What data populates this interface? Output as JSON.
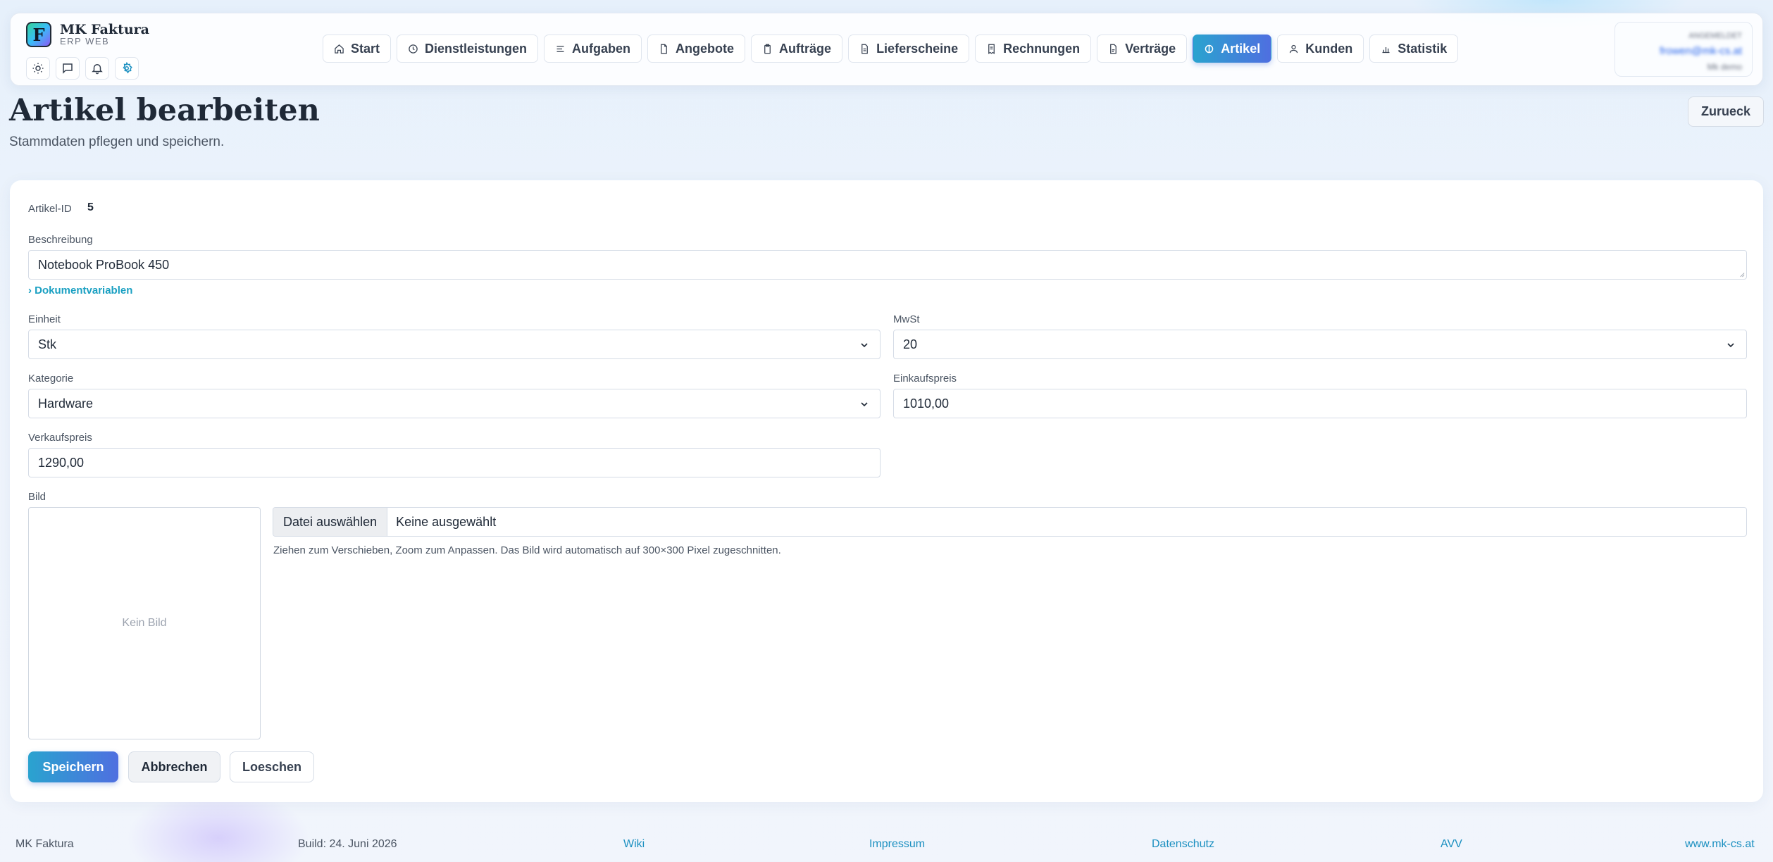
{
  "app": {
    "name": "MK Faktura",
    "subtitle": "ERP WEB",
    "logo_letter": "F"
  },
  "header_icons": [
    "sun-icon",
    "chat-icon",
    "bell-icon",
    "gear-icon"
  ],
  "nav": {
    "items": [
      {
        "label": "Start",
        "icon": "home-icon"
      },
      {
        "label": "Dienstleistungen",
        "icon": "clock-icon"
      },
      {
        "label": "Aufgaben",
        "icon": "list-icon"
      },
      {
        "label": "Angebote",
        "icon": "document-icon"
      },
      {
        "label": "Aufträge",
        "icon": "clipboard-icon"
      },
      {
        "label": "Lieferscheine",
        "icon": "document-icon"
      },
      {
        "label": "Rechnungen",
        "icon": "receipt-icon"
      },
      {
        "label": "Verträge",
        "icon": "document-icon"
      },
      {
        "label": "Artikel",
        "icon": "tag-icon",
        "active": true
      },
      {
        "label": "Kunden",
        "icon": "user-icon"
      },
      {
        "label": "Statistik",
        "icon": "chart-icon"
      }
    ]
  },
  "user": {
    "role": "ANGEMELDET",
    "email": "frowen@mk-cs.at",
    "tenant": "Mk demo"
  },
  "page": {
    "title": "Artikel bearbeiten",
    "subtitle": "Stammdaten pflegen und speichern.",
    "back_label": "Zurueck"
  },
  "form": {
    "id_label": "Artikel-ID",
    "id_value": "5",
    "description_label": "Beschreibung",
    "description_value": "Notebook ProBook 450",
    "doc_vars_label": "Dokumentvariablen",
    "unit_label": "Einheit",
    "unit_value": "Stk",
    "vat_label": "MwSt",
    "vat_value": "20",
    "category_label": "Kategorie",
    "category_value": "Hardware",
    "purchase_label": "Einkaufspreis",
    "purchase_value": "1010,00",
    "sale_label": "Verkaufspreis",
    "sale_value": "1290,00",
    "image_label": "Bild",
    "no_image": "Kein Bild",
    "file_button": "Datei auswählen",
    "file_status": "Keine ausgewählt",
    "image_hint": "Ziehen zum Verschieben, Zoom zum Anpassen. Das Bild wird automatisch auf 300×300 Pixel zugeschnitten."
  },
  "actions": {
    "save": "Speichern",
    "cancel": "Abbrechen",
    "delete": "Loeschen"
  },
  "footer": {
    "brand": "MK Faktura",
    "build": "Build: 24. Juni 2026",
    "wiki": "Wiki",
    "impressum": "Impressum",
    "datenschutz": "Datenschutz",
    "avv": "AVV",
    "website": "www.mk-cs.at"
  },
  "colors": {
    "accent_start": "#2aa3cf",
    "accent_end": "#4f6fe0",
    "link": "#1a8fc0"
  }
}
